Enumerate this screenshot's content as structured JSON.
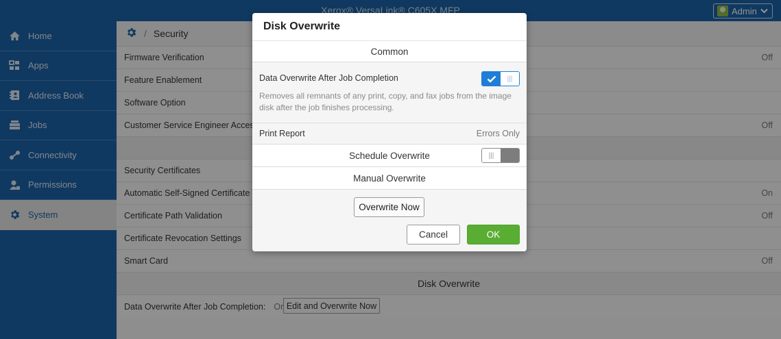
{
  "window": {
    "title": "Xerox® VersaLink® C605X MFP",
    "user_label": "Admin"
  },
  "sidebar": {
    "items": [
      {
        "label": "Home",
        "icon": "home-icon",
        "active": false
      },
      {
        "label": "Apps",
        "icon": "apps-grid-icon",
        "active": false
      },
      {
        "label": "Address Book",
        "icon": "address-book-icon",
        "active": false
      },
      {
        "label": "Jobs",
        "icon": "jobs-icon",
        "active": false
      },
      {
        "label": "Connectivity",
        "icon": "connectivity-icon",
        "active": false
      },
      {
        "label": "Permissions",
        "icon": "permissions-icon",
        "active": false
      },
      {
        "label": "System",
        "icon": "gear-icon",
        "active": true
      }
    ]
  },
  "breadcrumb": {
    "icon": "gear-icon",
    "separator": "/",
    "current": "Security"
  },
  "settings": {
    "rows": [
      {
        "label": "Firmware Verification",
        "value": "Off"
      },
      {
        "label": "Feature Enablement",
        "value": ""
      },
      {
        "label": "Software Option",
        "value": ""
      },
      {
        "label": "Customer Service Engineer Access",
        "value": "Off"
      },
      {
        "label": "",
        "value": ""
      },
      {
        "label": "Security Certificates",
        "value": ""
      },
      {
        "label": "Automatic Self-Signed Certificate C",
        "value": "On"
      },
      {
        "label": "Certificate Path Validation",
        "value": "Off"
      },
      {
        "label": "Certificate Revocation Settings",
        "value": ""
      },
      {
        "label": "Smart Card",
        "value": "Off"
      }
    ],
    "section_title": "Disk Overwrite",
    "overwrite_status_label": "Data Overwrite After Job Completion:",
    "overwrite_status_value": "On",
    "edit_button": "Edit and Overwrite Now"
  },
  "dialog": {
    "title": "Disk Overwrite",
    "common_header": "Common",
    "data_overwrite_label": "Data Overwrite After Job Completion",
    "data_overwrite_enabled": true,
    "data_overwrite_desc": "Removes all remnants of any print, copy, and fax jobs from the image disk after the job finishes processing.",
    "print_report_label": "Print Report",
    "print_report_value": "Errors Only",
    "schedule_label": "Schedule Overwrite",
    "schedule_enabled": false,
    "manual_header": "Manual Overwrite",
    "overwrite_now_button": "Overwrite Now",
    "cancel_button": "Cancel",
    "ok_button": "OK"
  },
  "colors": {
    "brand_blue": "#1c62a8",
    "toggle_blue": "#1f7ed6",
    "ok_green": "#5aad33"
  }
}
